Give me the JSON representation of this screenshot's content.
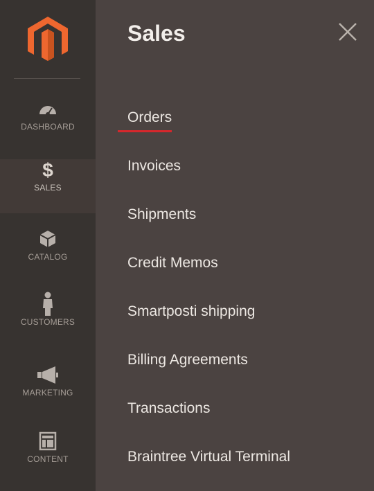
{
  "colors": {
    "sidebar_bg": "#373330",
    "panel_bg": "#4b4341",
    "brand_orange": "#ee672f",
    "underline_red": "#d6272c"
  },
  "sidebar": {
    "logo_icon": "magento-logo-icon",
    "items": [
      {
        "label": "DASHBOARD",
        "icon": "speedometer-icon"
      },
      {
        "label": "SALES",
        "icon": "dollar-icon"
      },
      {
        "label": "CATALOG",
        "icon": "box-icon"
      },
      {
        "label": "CUSTOMERS",
        "icon": "person-icon"
      },
      {
        "label": "MARKETING",
        "icon": "megaphone-icon"
      },
      {
        "label": "CONTENT",
        "icon": "layout-icon"
      }
    ]
  },
  "panel": {
    "title": "Sales",
    "close_icon": "close-icon",
    "menu": [
      {
        "label": "Orders"
      },
      {
        "label": "Invoices"
      },
      {
        "label": "Shipments"
      },
      {
        "label": "Credit Memos"
      },
      {
        "label": "Smartposti shipping"
      },
      {
        "label": "Billing Agreements"
      },
      {
        "label": "Transactions"
      },
      {
        "label": "Braintree Virtual Terminal"
      }
    ]
  }
}
